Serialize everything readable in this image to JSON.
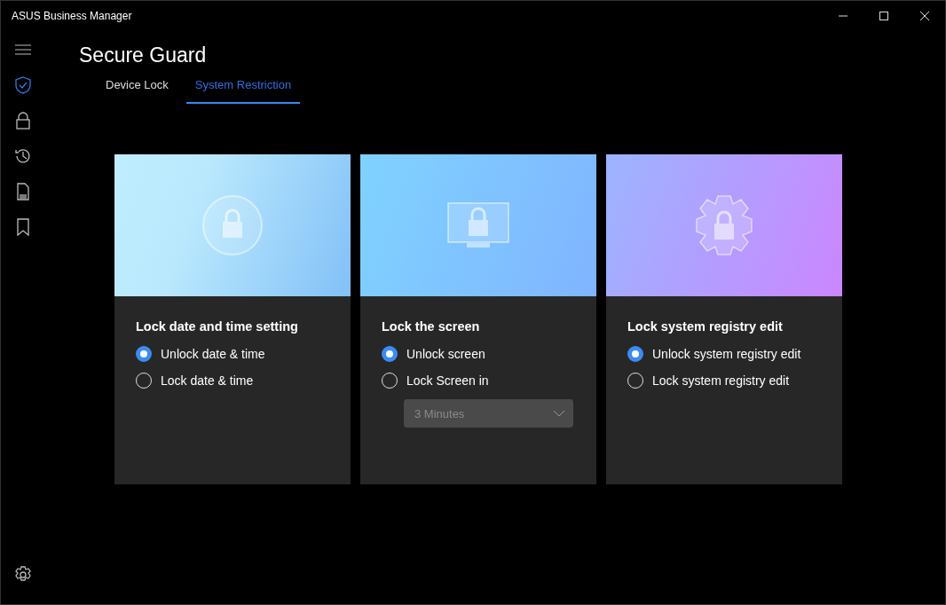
{
  "window": {
    "title": "ASUS Business Manager"
  },
  "sidebar": {
    "items": [
      {
        "kind": "shield",
        "selected": true
      },
      {
        "kind": "lock",
        "selected": false
      },
      {
        "kind": "history",
        "selected": false
      },
      {
        "kind": "file",
        "selected": false
      },
      {
        "kind": "bookmark",
        "selected": false
      }
    ]
  },
  "page": {
    "title": "Secure Guard"
  },
  "tabs": [
    {
      "label": "Device Lock",
      "selected": false
    },
    {
      "label": "System Restriction",
      "selected": true
    }
  ],
  "cards": [
    {
      "kind": "clock",
      "title": "Lock date and time setting",
      "options": [
        {
          "label": "Unlock date & time",
          "selected": true
        },
        {
          "label": "Lock date & time",
          "selected": false
        }
      ]
    },
    {
      "kind": "monitor",
      "title": "Lock the screen",
      "options": [
        {
          "label": "Unlock screen",
          "selected": true
        },
        {
          "label": "Lock Screen in",
          "selected": false
        }
      ],
      "dropdown": {
        "value": "3 Minutes",
        "disabled": true
      }
    },
    {
      "kind": "gear",
      "title": "Lock system registry edit",
      "options": [
        {
          "label": "Unlock system registry edit",
          "selected": true
        },
        {
          "label": "Lock system registry edit",
          "selected": false
        }
      ]
    }
  ]
}
